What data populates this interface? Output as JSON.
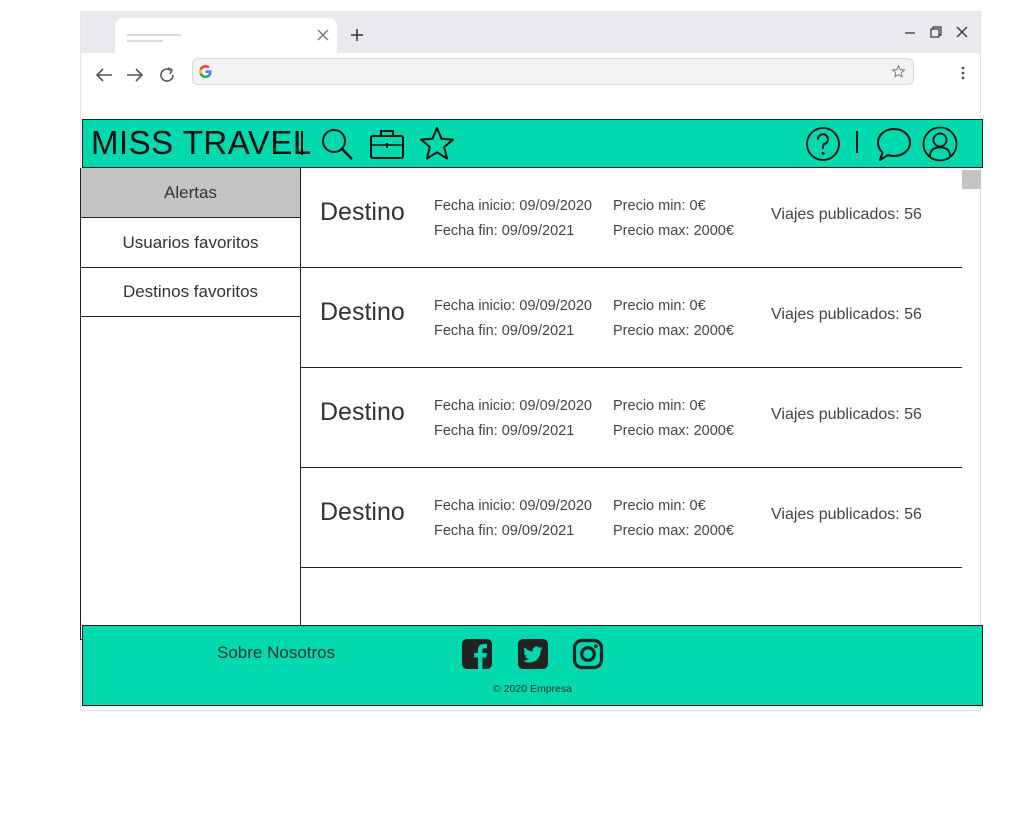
{
  "browser": {
    "tab_icons": [
      "close-icon",
      "plus-icon"
    ],
    "window_icons": [
      "minimize-icon",
      "maximize-icon",
      "close-icon"
    ],
    "nav_icons": [
      "back-arrow-icon",
      "forward-arrow-icon",
      "reload-icon"
    ],
    "omnibox_icons": [
      "google-icon",
      "star-icon"
    ],
    "menu_icon": "kebab-menu-icon"
  },
  "header": {
    "brand": "MISS TRAVEL",
    "left_icons": [
      "search-icon",
      "briefcase-icon",
      "star-icon"
    ],
    "right_icons": [
      "help-icon",
      "chat-icon",
      "user-icon"
    ],
    "color": "#00d9ad"
  },
  "sidebar": {
    "items": [
      {
        "label": "Alertas",
        "active": true
      },
      {
        "label": "Usuarios favoritos",
        "active": false
      },
      {
        "label": "Destinos favoritos",
        "active": false
      }
    ]
  },
  "alerts": [
    {
      "destination": "Destino",
      "start": "Fecha inicio: 09/09/2020",
      "end": "Fecha fin: 09/09/2021",
      "price_min": "Precio min: 0€",
      "price_max": "Precio max: 2000€",
      "published": "Viajes publicados: 56"
    },
    {
      "destination": "Destino",
      "start": "Fecha inicio: 09/09/2020",
      "end": "Fecha fin: 09/09/2021",
      "price_min": "Precio min: 0€",
      "price_max": "Precio max: 2000€",
      "published": "Viajes publicados: 56"
    },
    {
      "destination": "Destino",
      "start": "Fecha inicio: 09/09/2020",
      "end": "Fecha fin: 09/09/2021",
      "price_min": "Precio min: 0€",
      "price_max": "Precio max: 2000€",
      "published": "Viajes publicados: 56"
    },
    {
      "destination": "Destino",
      "start": "Fecha inicio: 09/09/2020",
      "end": "Fecha fin: 09/09/2021",
      "price_min": "Precio min: 0€",
      "price_max": "Precio max: 2000€",
      "published": "Viajes publicados: 56"
    }
  ],
  "footer": {
    "about": "Sobre Nosotros",
    "social_icons": [
      "facebook-icon",
      "twitter-icon",
      "instagram-icon"
    ],
    "copyright": "© 2020 Empresa"
  }
}
